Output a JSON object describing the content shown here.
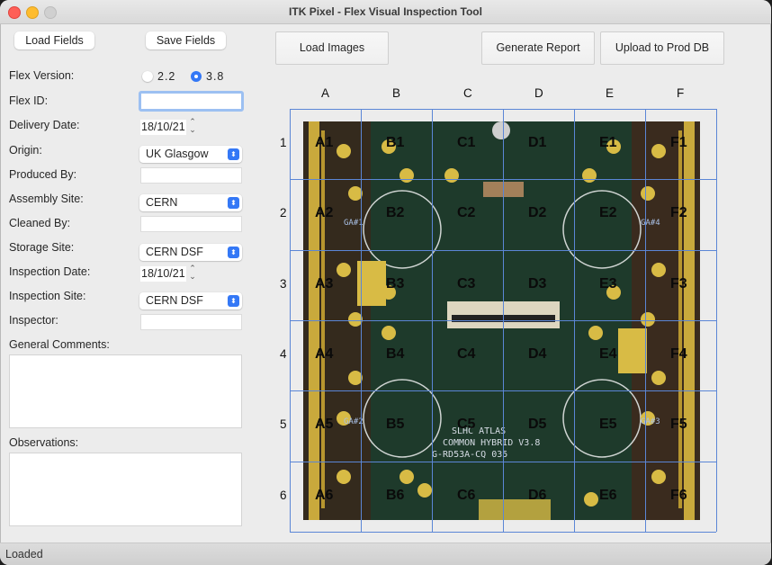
{
  "window": {
    "title": "ITK Pixel - Flex Visual Inspection Tool"
  },
  "toolbar": {
    "load_fields": "Load Fields",
    "save_fields": "Save Fields",
    "load_images": "Load Images",
    "generate_report": "Generate Report",
    "upload": "Upload to Prod DB"
  },
  "form": {
    "flex_version": {
      "label": "Flex Version:",
      "options": [
        "2.2",
        "3.8"
      ],
      "selected": "3.8"
    },
    "flex_id": {
      "label": "Flex ID:",
      "value": ""
    },
    "delivery_date": {
      "label": "Delivery Date:",
      "value": "18/10/21"
    },
    "origin": {
      "label": "Origin:",
      "value": "UK Glasgow"
    },
    "produced_by": {
      "label": "Produced By:",
      "value": ""
    },
    "assembly_site": {
      "label": "Assembly Site:",
      "value": "CERN"
    },
    "cleaned_by": {
      "label": "Cleaned By:",
      "value": ""
    },
    "storage_site": {
      "label": "Storage Site:",
      "value": "CERN DSF"
    },
    "inspection_date": {
      "label": "Inspection Date:",
      "value": "18/10/21"
    },
    "inspection_site": {
      "label": "Inspection Site:",
      "value": "CERN DSF"
    },
    "inspector": {
      "label": "Inspector:",
      "value": ""
    },
    "general_comments": {
      "label": "General Comments:",
      "value": ""
    },
    "observations": {
      "label": "Observations:",
      "value": ""
    }
  },
  "grid": {
    "columns": [
      "A",
      "B",
      "C",
      "D",
      "E",
      "F"
    ],
    "rows": [
      "1",
      "2",
      "3",
      "4",
      "5",
      "6"
    ],
    "cells": [
      [
        "A1",
        "B1",
        "C1",
        "D1",
        "E1",
        "F1"
      ],
      [
        "A2",
        "B2",
        "C2",
        "D2",
        "E2",
        "F2"
      ],
      [
        "A3",
        "B3",
        "C3",
        "D3",
        "E3",
        "F3"
      ],
      [
        "A4",
        "B4",
        "C4",
        "D4",
        "E4",
        "F4"
      ],
      [
        "A5",
        "B5",
        "C5",
        "D5",
        "E5",
        "F5"
      ],
      [
        "A6",
        "B6",
        "C6",
        "D6",
        "E6",
        "F6"
      ]
    ]
  },
  "board": {
    "silkscreen": [
      "SLHC ATLAS",
      "COMMON HYBRID V3.8",
      "G-RD53A-CQ     035"
    ],
    "markers": [
      "GA#1",
      "GA#2",
      "GA#3",
      "GA#4"
    ]
  },
  "status": {
    "text": "Loaded"
  }
}
